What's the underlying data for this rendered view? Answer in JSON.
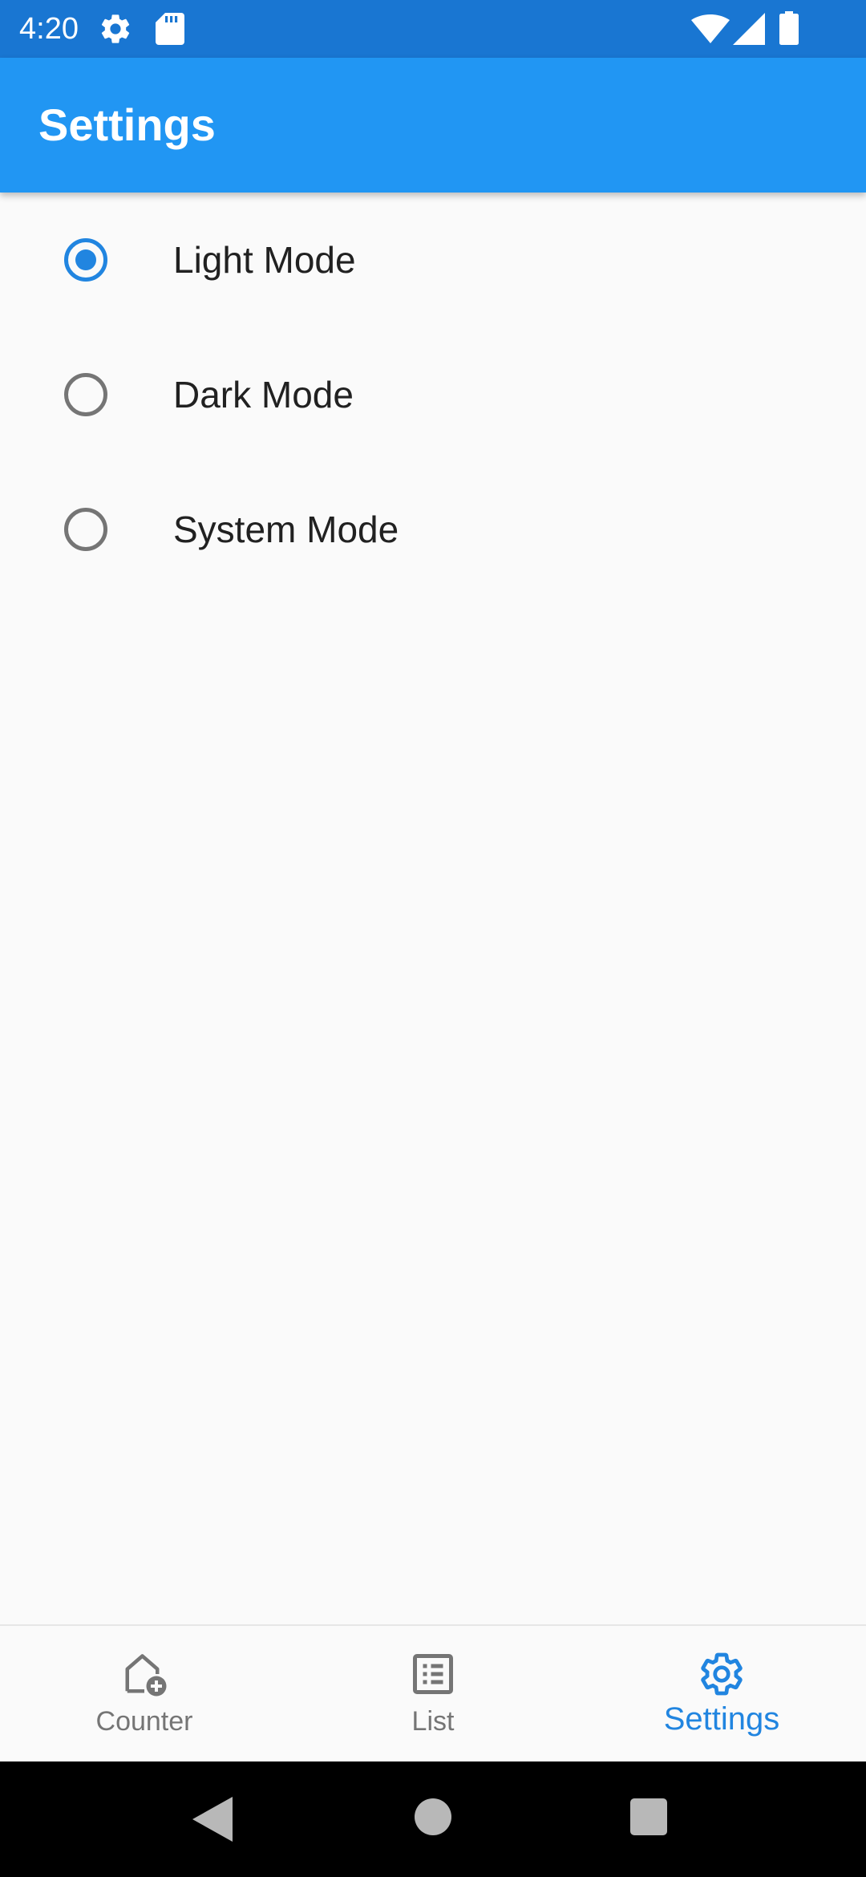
{
  "status_bar": {
    "time": "4:20",
    "icons": [
      "settings-gear-icon",
      "sd-card-icon",
      "wifi-icon",
      "cell-signal-icon",
      "battery-icon"
    ]
  },
  "app_bar": {
    "title": "Settings"
  },
  "theme_options": [
    {
      "label": "Light Mode",
      "selected": true
    },
    {
      "label": "Dark Mode",
      "selected": false
    },
    {
      "label": "System Mode",
      "selected": false
    }
  ],
  "bottom_nav": {
    "items": [
      {
        "label": "Counter",
        "icon": "home-add-icon",
        "active": false
      },
      {
        "label": "List",
        "icon": "list-icon",
        "active": false
      },
      {
        "label": "Settings",
        "icon": "settings-icon",
        "active": true
      }
    ]
  },
  "system_nav": {
    "buttons": [
      "back-icon",
      "home-icon",
      "recents-icon"
    ]
  },
  "colors": {
    "status_bar": "#1976D2",
    "app_bar": "#2196F3",
    "accent": "#2185E0",
    "inactive": "#757575",
    "background": "#FAFAFA"
  }
}
